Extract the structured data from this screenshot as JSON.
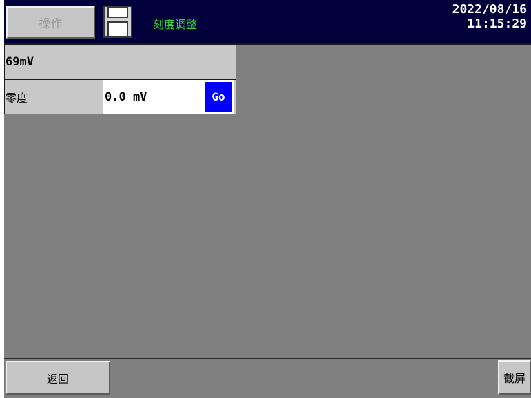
{
  "header": {
    "operation_label": "操作",
    "save_icon": "floppy-disk-icon",
    "title": "刻度调整",
    "date": "2022/08/16",
    "time": "11:15:29"
  },
  "panel": {
    "reading": "69mV",
    "zero_label": "零度",
    "zero_value": "0.0 mV",
    "go_label": "Go"
  },
  "footer": {
    "back_label": "返回",
    "screenshot_label": "截屏"
  },
  "colors": {
    "header_bg": "#00003a",
    "title_green": "#33d633",
    "go_blue": "#0000ff",
    "screen_gray": "#808080"
  }
}
